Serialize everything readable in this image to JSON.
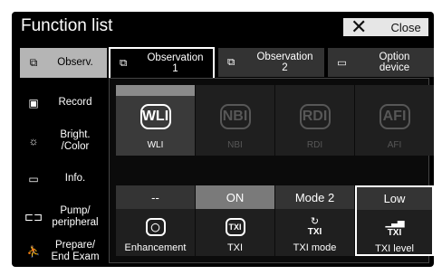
{
  "header": {
    "title": "Function list",
    "close_label": "Close"
  },
  "sidebar": {
    "items": [
      {
        "label": "Observ.",
        "active": true
      },
      {
        "label": "Record"
      },
      {
        "label": "Bright.\n/Color"
      },
      {
        "label": "Info."
      },
      {
        "label": "Pump/\nperipheral"
      },
      {
        "label": "Prepare/\nEnd Exam"
      }
    ]
  },
  "tabs": [
    {
      "label": "Observation\n1"
    },
    {
      "label": "Observation\n2"
    },
    {
      "label": "Option\ndevice"
    }
  ],
  "modes": [
    {
      "glyph": "WLI",
      "caption": "WLI"
    },
    {
      "glyph": "NBI",
      "caption": "NBI"
    },
    {
      "glyph": "RDI",
      "caption": "RDI"
    },
    {
      "glyph": "AFI",
      "caption": "AFI"
    }
  ],
  "controls": [
    {
      "status": "--",
      "caption": "Enhancement"
    },
    {
      "status": "ON",
      "glyph": "TXI",
      "caption": "TXI"
    },
    {
      "status": "Mode 2",
      "glyph": "TXI",
      "caption": "TXI mode"
    },
    {
      "status": "Low",
      "glyph": "TXI",
      "caption": "TXI level"
    }
  ]
}
